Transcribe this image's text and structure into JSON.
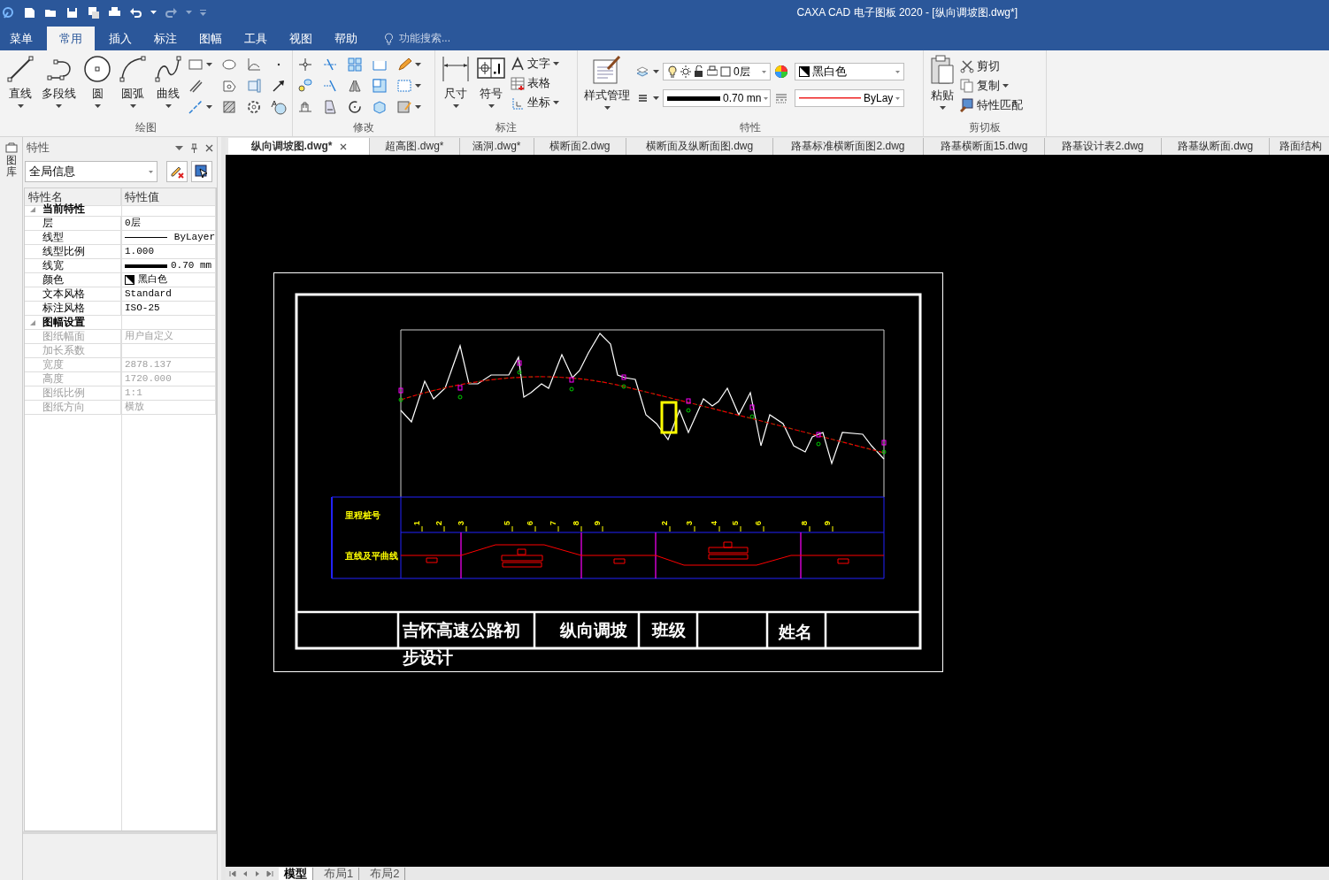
{
  "window": {
    "title": "CAXA CAD 电子图板 2020 - [纵向调坡图.dwg*]"
  },
  "menu_tabs": [
    {
      "label": "菜单",
      "selected": false
    },
    {
      "label": "常用",
      "selected": true
    },
    {
      "label": "插入",
      "selected": false
    },
    {
      "label": "标注",
      "selected": false
    },
    {
      "label": "图幅",
      "selected": false
    },
    {
      "label": "工具",
      "selected": false
    },
    {
      "label": "视图",
      "selected": false
    },
    {
      "label": "帮助",
      "selected": false
    }
  ],
  "search": {
    "placeholder": "功能搜索..."
  },
  "ribbon": {
    "draw": {
      "title": "绘图",
      "buttons": [
        "直线",
        "多段线",
        "圆",
        "圆弧",
        "曲线"
      ]
    },
    "modify": {
      "title": "修改"
    },
    "annotate": {
      "title": "标注",
      "buttons": [
        "尺寸",
        "符号"
      ],
      "small_buttons": [
        "文字",
        "表格",
        "坐标"
      ]
    },
    "properties": {
      "title": "特性",
      "style_button": "样式管理",
      "layer": "0层",
      "color_name": "黑白色",
      "lineweight": "0.70 mn",
      "linetype": "ByLay"
    },
    "clipboard": {
      "title": "剪切板",
      "paste": "粘贴",
      "small_buttons": [
        "剪切",
        "复制",
        "特性匹配"
      ]
    }
  },
  "side_tab": {
    "label": "图库"
  },
  "properties_panel": {
    "title": "特性",
    "selector": "全局信息",
    "columns": [
      "特性名",
      "特性值"
    ],
    "groups": [
      {
        "label": "当前特性",
        "expanded": true,
        "rows": [
          {
            "name": "层",
            "value": "0层",
            "kind": "text",
            "disabled": false
          },
          {
            "name": "线型",
            "value": "ByLayer",
            "kind": "linetype",
            "disabled": false
          },
          {
            "name": "线型比例",
            "value": "1.000",
            "kind": "text",
            "disabled": false
          },
          {
            "name": "线宽",
            "value": "0.70 mm",
            "kind": "lineweight",
            "disabled": false
          },
          {
            "name": "颜色",
            "value": "黑白色",
            "kind": "color",
            "disabled": false
          },
          {
            "name": "文本风格",
            "value": "Standard",
            "kind": "text",
            "disabled": false
          },
          {
            "name": "标注风格",
            "value": "ISO-25",
            "kind": "text",
            "disabled": false
          }
        ]
      },
      {
        "label": "图幅设置",
        "expanded": true,
        "rows": [
          {
            "name": "图纸幅面",
            "value": "用户自定义",
            "kind": "text",
            "disabled": true
          },
          {
            "name": "加长系数",
            "kind": "text",
            "disabled": true
          },
          {
            "name": "宽度",
            "value": "2878.137",
            "kind": "text",
            "disabled": true
          },
          {
            "name": "高度",
            "value": "1720.000",
            "kind": "text",
            "disabled": true
          },
          {
            "name": "图纸比例",
            "value": "1:1",
            "kind": "text",
            "disabled": true
          },
          {
            "name": "图纸方向",
            "value": "横放",
            "kind": "text",
            "disabled": true
          }
        ]
      }
    ]
  },
  "doc_tabs": [
    {
      "label": "纵向调坡图.dwg*",
      "selected": true
    },
    {
      "label": "超高图.dwg*",
      "selected": false
    },
    {
      "label": "涵洞.dwg*",
      "selected": false
    },
    {
      "label": "横断面2.dwg",
      "selected": false
    },
    {
      "label": "横断面及纵断面图.dwg",
      "selected": false
    },
    {
      "label": "路基标准横断面图2.dwg",
      "selected": false
    },
    {
      "label": "路基横断面15.dwg",
      "selected": false
    },
    {
      "label": "路基设计表2.dwg",
      "selected": false
    },
    {
      "label": "路基纵断面.dwg",
      "selected": false
    },
    {
      "label": "路面结构",
      "selected": false
    }
  ],
  "drawing": {
    "row_labels": [
      "里程桩号",
      "直线及平曲线"
    ],
    "stake_labels": [
      "1",
      "2",
      "3",
      "5",
      "6",
      "7",
      "8",
      "9",
      "2",
      "3",
      "4",
      "5",
      "6",
      "8",
      "9"
    ],
    "title_block": [
      "吉怀高速公路初步设计",
      "纵向调坡",
      "班级",
      "姓名"
    ]
  },
  "layout_tabs": [
    {
      "label": "模型",
      "selected": true
    },
    {
      "label": "布局1",
      "selected": false
    },
    {
      "label": "布局2",
      "selected": false
    }
  ]
}
